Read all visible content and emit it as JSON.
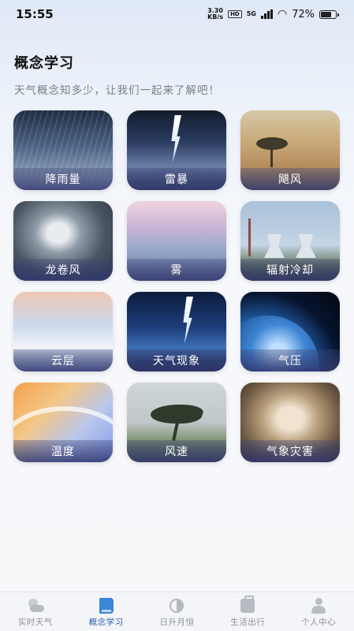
{
  "status_bar": {
    "time": "15:55",
    "net_speed_value": "3.30",
    "net_speed_unit": "KB/s",
    "hd_label": "HD",
    "network_label": "5G",
    "battery_percent": "72%",
    "battery_level": 0.72
  },
  "page": {
    "title": "概念学习",
    "subtitle": "天气概念知多少，让我们一起来了解吧！"
  },
  "cards": [
    {
      "label": "降雨量",
      "icon": "rain-image"
    },
    {
      "label": "雷暴",
      "icon": "thunderstorm-image"
    },
    {
      "label": "飓风",
      "icon": "hurricane-image"
    },
    {
      "label": "龙卷风",
      "icon": "tornado-image"
    },
    {
      "label": "雾",
      "icon": "fog-image"
    },
    {
      "label": "辐射冷却",
      "icon": "radiative-cooling-image"
    },
    {
      "label": "云层",
      "icon": "cloud-layer-image"
    },
    {
      "label": "天气现象",
      "icon": "weather-phenomena-image"
    },
    {
      "label": "气压",
      "icon": "air-pressure-image"
    },
    {
      "label": "温度",
      "icon": "temperature-image"
    },
    {
      "label": "风速",
      "icon": "wind-speed-image"
    },
    {
      "label": "气象灾害",
      "icon": "meteorological-disaster-image"
    }
  ],
  "tab_bar": {
    "active_index": 1,
    "tabs": [
      {
        "label": "实时天气",
        "icon": "sun-cloud-icon"
      },
      {
        "label": "概念学习",
        "icon": "book-icon"
      },
      {
        "label": "日升月恒",
        "icon": "moon-icon"
      },
      {
        "label": "生活出行",
        "icon": "luggage-icon"
      },
      {
        "label": "个人中心",
        "icon": "person-icon"
      }
    ]
  },
  "colors": {
    "active_tab": "#2c5fa8",
    "inactive_tab": "#8c9097",
    "card_label_bg": "#323770"
  }
}
